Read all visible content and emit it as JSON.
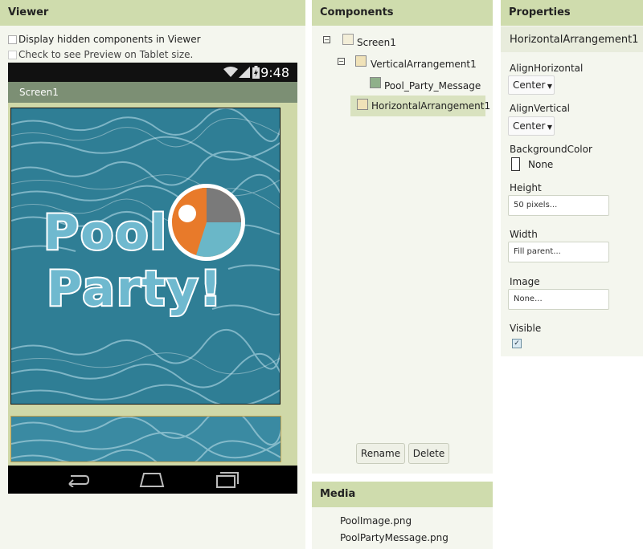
{
  "viewer": {
    "title": "Viewer",
    "hidden_components_label": "Display hidden components in Viewer",
    "tablet_preview_label": "Check to see Preview on Tablet size.",
    "phone": {
      "clock": "9:48",
      "screen_title": "Screen1",
      "image_text_line1": "Pool",
      "image_text_line2": "Party!"
    }
  },
  "components": {
    "title": "Components",
    "tree": [
      {
        "label": "Screen1",
        "icon": "screen-icon"
      },
      {
        "label": "VerticalArrangement1",
        "icon": "vertical-arrangement-icon"
      },
      {
        "label": "Pool_Party_Message",
        "icon": "image-icon"
      },
      {
        "label": "HorizontalArrangement1",
        "icon": "horizontal-arrangement-icon",
        "selected": true
      }
    ],
    "rename_label": "Rename",
    "delete_label": "Delete"
  },
  "media": {
    "title": "Media",
    "files": [
      "PoolImage.png",
      "PoolPartyMessage.png"
    ]
  },
  "properties": {
    "title": "Properties",
    "component_name": "HorizontalArrangement1",
    "align_horizontal": {
      "label": "AlignHorizontal",
      "value": "Center"
    },
    "align_vertical": {
      "label": "AlignVertical",
      "value": "Center"
    },
    "background_color": {
      "label": "BackgroundColor",
      "value": "None"
    },
    "height": {
      "label": "Height",
      "value": "50 pixels..."
    },
    "width": {
      "label": "Width",
      "value": "Fill parent..."
    },
    "image": {
      "label": "Image",
      "value": "None..."
    },
    "visible": {
      "label": "Visible",
      "checked": true
    }
  },
  "colors": {
    "panel_header": "#cfdcad",
    "panel_bg": "#f4f6ee",
    "selected_row": "#d9e2bf",
    "water": "#2f7e95",
    "ball_orange": "#e87a2a",
    "ball_teal": "#6ab7c8"
  }
}
